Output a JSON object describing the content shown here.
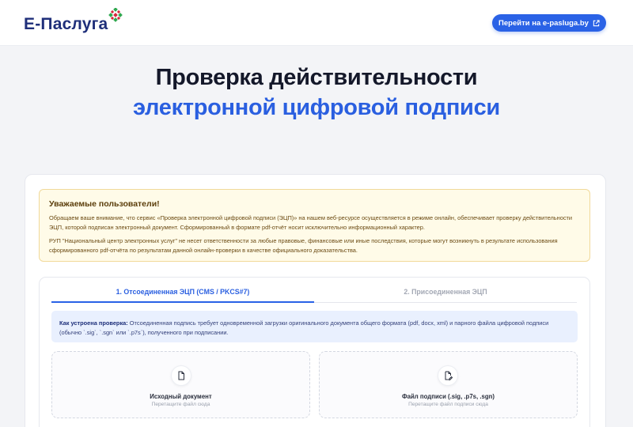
{
  "header": {
    "logo_text": "E-Паслуга",
    "cta_label": "Перейти на e-pasluga.by",
    "cta_icon": "external-link-icon",
    "logo_icon": "ornament-icon",
    "brand_color": "#1f2f7a",
    "accent_color": "#2a62e6"
  },
  "hero": {
    "title_line1": "Проверка действительности",
    "title_line2": "электронной цифровой подписи"
  },
  "notice": {
    "title": "Уважаемые пользователи!",
    "paragraph1": "Обращаем ваше внимание, что сервис «Проверка электронной цифровой подписи (ЭЦП)» на нашем веб-ресурсе осуществляется в режиме онлайн, обеспечивает проверку действительности ЭЦП, которой подписан электронный документ. Сформированный в формате pdf-отчёт носит исключительно информационный характер.",
    "paragraph2": "РУП \"Национальный центр электронных услуг\" не несет ответственности за любые правовые, финансовые или иные последствия, которые могут возникнуть в результате использования сформированного pdf-отчёта по результатам данной онлайн-проверки в качестве официального доказательства."
  },
  "tabs": [
    {
      "label": "1. Отсоединенная ЭЦП (CMS / PKCS#7)",
      "active": true
    },
    {
      "label": "2. Присоединенная ЭЦП",
      "active": false
    }
  ],
  "howto": {
    "lead": "Как устроена проверка:",
    "text": " Отсоединенная подпись требует одновременной загрузки оригинального документа общего формата (pdf, docx, xml) и парного файла цифровой подписи (обычно `.sig`, `.sgn` или `.p7s`), полученного при подписании."
  },
  "dropzones": [
    {
      "title": "Исходный документ",
      "hint": "Перетащите файл сюда",
      "icon": "file-icon"
    },
    {
      "title": "Файл подписи (.sig, .p7s, .sgn)",
      "hint": "Перетащите файл подписи сюда",
      "icon": "file-signature-icon"
    }
  ]
}
